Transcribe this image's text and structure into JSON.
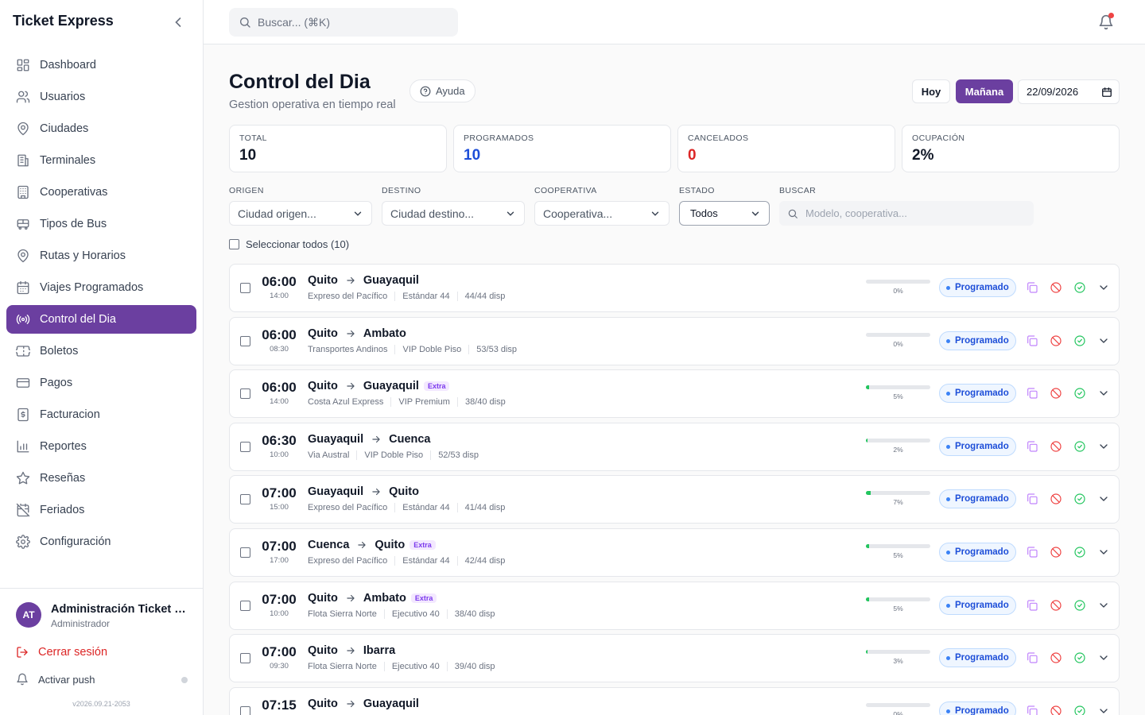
{
  "app": {
    "title": "Ticket Express"
  },
  "sidebar": {
    "items": [
      {
        "label": "Dashboard",
        "icon": "dashboard-icon"
      },
      {
        "label": "Usuarios",
        "icon": "users-icon"
      },
      {
        "label": "Ciudades",
        "icon": "map-pin-icon"
      },
      {
        "label": "Terminales",
        "icon": "building-icon"
      },
      {
        "label": "Cooperativas",
        "icon": "cooperative-icon"
      },
      {
        "label": "Tipos de Bus",
        "icon": "bus-icon"
      },
      {
        "label": "Rutas y Horarios",
        "icon": "route-icon"
      },
      {
        "label": "Viajes Programados",
        "icon": "calendar-icon"
      },
      {
        "label": "Control del Dia",
        "icon": "broadcast-icon",
        "active": true
      },
      {
        "label": "Boletos",
        "icon": "ticket-icon"
      },
      {
        "label": "Pagos",
        "icon": "credit-card-icon"
      },
      {
        "label": "Facturacion",
        "icon": "invoice-icon"
      },
      {
        "label": "Reportes",
        "icon": "bar-chart-icon"
      },
      {
        "label": "Reseñas",
        "icon": "star-icon"
      },
      {
        "label": "Feriados",
        "icon": "calendar-off-icon"
      },
      {
        "label": "Configuración",
        "icon": "gear-icon"
      }
    ]
  },
  "user": {
    "initials": "AT",
    "name": "Administración Ticket Express",
    "role": "Administrador"
  },
  "footer": {
    "logout": "Cerrar sesión",
    "push": "Activar push",
    "version": "v2026.09.21-2053"
  },
  "topbar": {
    "search_placeholder": "Buscar... (⌘K)"
  },
  "page": {
    "title": "Control del Dia",
    "subtitle": "Gestion operativa en tiempo real",
    "help": "Ayuda",
    "today": "Hoy",
    "tomorrow": "Mañana",
    "date": "22/09/2026"
  },
  "stats": [
    {
      "label": "TOTAL",
      "value": "10",
      "color": "#111827"
    },
    {
      "label": "PROGRAMADOS",
      "value": "10",
      "color": "#1d4ed8"
    },
    {
      "label": "CANCELADOS",
      "value": "0",
      "color": "#dc2626"
    },
    {
      "label": "OCUPACIÓN",
      "value": "2%",
      "color": "#111827"
    }
  ],
  "filters": {
    "origin_label": "ORIGEN",
    "origin_placeholder": "Ciudad origen...",
    "destination_label": "DESTINO",
    "destination_placeholder": "Ciudad destino...",
    "coop_label": "COOPERATIVA",
    "coop_placeholder": "Cooperativa...",
    "status_label": "ESTADO",
    "status_value": "Todos",
    "search_label": "BUSCAR",
    "search_placeholder": "Modelo, cooperativa..."
  },
  "select_all": "Seleccionar todos (10)",
  "colors": {
    "accent": "#6b3fa0",
    "status_blue": "#1d4ed8",
    "danger": "#dc2626",
    "success": "#22c55e"
  },
  "trips": [
    {
      "dep": "06:00",
      "arr": "14:00",
      "origin": "Quito",
      "destination": "Guayaquil",
      "extra": "",
      "coop": "Expreso del Pacífico",
      "bus": "Estándar 44",
      "avail": "44/44 disp",
      "occupancy": 0,
      "occ_label": "0%",
      "status": "Programado"
    },
    {
      "dep": "06:00",
      "arr": "08:30",
      "origin": "Quito",
      "destination": "Ambato",
      "extra": "",
      "coop": "Transportes Andinos",
      "bus": "VIP Doble Piso",
      "avail": "53/53 disp",
      "occupancy": 0,
      "occ_label": "0%",
      "status": "Programado"
    },
    {
      "dep": "06:00",
      "arr": "14:00",
      "origin": "Quito",
      "destination": "Guayaquil",
      "extra": "Extra",
      "coop": "Costa Azul Express",
      "bus": "VIP Premium",
      "avail": "38/40 disp",
      "occupancy": 5,
      "occ_label": "5%",
      "status": "Programado"
    },
    {
      "dep": "06:30",
      "arr": "10:00",
      "origin": "Guayaquil",
      "destination": "Cuenca",
      "extra": "",
      "coop": "Via Austral",
      "bus": "VIP Doble Piso",
      "avail": "52/53 disp",
      "occupancy": 2,
      "occ_label": "2%",
      "status": "Programado"
    },
    {
      "dep": "07:00",
      "arr": "15:00",
      "origin": "Guayaquil",
      "destination": "Quito",
      "extra": "",
      "coop": "Expreso del Pacífico",
      "bus": "Estándar 44",
      "avail": "41/44 disp",
      "occupancy": 7,
      "occ_label": "7%",
      "status": "Programado"
    },
    {
      "dep": "07:00",
      "arr": "17:00",
      "origin": "Cuenca",
      "destination": "Quito",
      "extra": "Extra",
      "coop": "Expreso del Pacífico",
      "bus": "Estándar 44",
      "avail": "42/44 disp",
      "occupancy": 5,
      "occ_label": "5%",
      "status": "Programado"
    },
    {
      "dep": "07:00",
      "arr": "10:00",
      "origin": "Quito",
      "destination": "Ambato",
      "extra": "Extra",
      "coop": "Flota Sierra Norte",
      "bus": "Ejecutivo 40",
      "avail": "38/40 disp",
      "occupancy": 5,
      "occ_label": "5%",
      "status": "Programado"
    },
    {
      "dep": "07:00",
      "arr": "09:30",
      "origin": "Quito",
      "destination": "Ibarra",
      "extra": "",
      "coop": "Flota Sierra Norte",
      "bus": "Ejecutivo 40",
      "avail": "39/40 disp",
      "occupancy": 3,
      "occ_label": "3%",
      "status": "Programado"
    },
    {
      "dep": "07:15",
      "arr": "",
      "origin": "Quito",
      "destination": "Guayaquil",
      "extra": "",
      "coop": "",
      "bus": "",
      "avail": "",
      "occupancy": 0,
      "occ_label": "0%",
      "status": "Programado"
    }
  ]
}
